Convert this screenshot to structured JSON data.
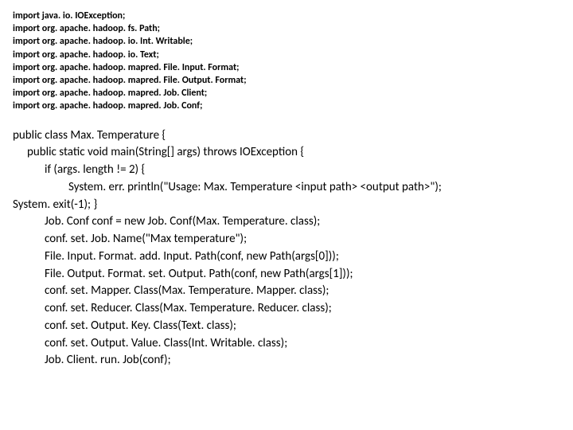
{
  "imports": [
    "import java. io. IOException;",
    "import org. apache. hadoop. fs. Path;",
    "import org. apache. hadoop. io. Int. Writable;",
    "import org. apache. hadoop. io. Text;",
    "import org. apache. hadoop. mapred. File. Input. Format;",
    "import org. apache. hadoop. mapred. File. Output. Format;",
    "import org. apache. hadoop. mapred. Job. Client;",
    "import org. apache. hadoop. mapred. Job. Conf;"
  ],
  "code": [
    {
      "indent": 0,
      "text": "public class Max. Temperature {"
    },
    {
      "indent": 1,
      "text": "public static void main(String[] args) throws IOException {"
    },
    {
      "indent": 2,
      "text": "if (args. length != 2) {"
    },
    {
      "indent": 3,
      "text": "System. err. println(\"Usage: Max. Temperature <input path> <output path>\");"
    },
    {
      "indent": 0,
      "text": "System. exit(-1); }"
    },
    {
      "indent": 2,
      "text": "Job. Conf conf = new Job. Conf(Max. Temperature. class);"
    },
    {
      "indent": 2,
      "text": "conf. set. Job. Name(\"Max temperature\");"
    },
    {
      "indent": 2,
      "text": "File. Input. Format. add. Input. Path(conf, new Path(args[0]));"
    },
    {
      "indent": 2,
      "text": "File. Output. Format. set. Output. Path(conf, new Path(args[1]));"
    },
    {
      "indent": 2,
      "text": "conf. set. Mapper. Class(Max. Temperature. Mapper. class);"
    },
    {
      "indent": 2,
      "text": "conf. set. Reducer. Class(Max. Temperature. Reducer. class);"
    },
    {
      "indent": 2,
      "text": "conf. set. Output. Key. Class(Text. class);"
    },
    {
      "indent": 2,
      "text": "conf. set. Output. Value. Class(Int. Writable. class);"
    },
    {
      "indent": 2,
      "text": "Job. Client. run. Job(conf);"
    }
  ]
}
